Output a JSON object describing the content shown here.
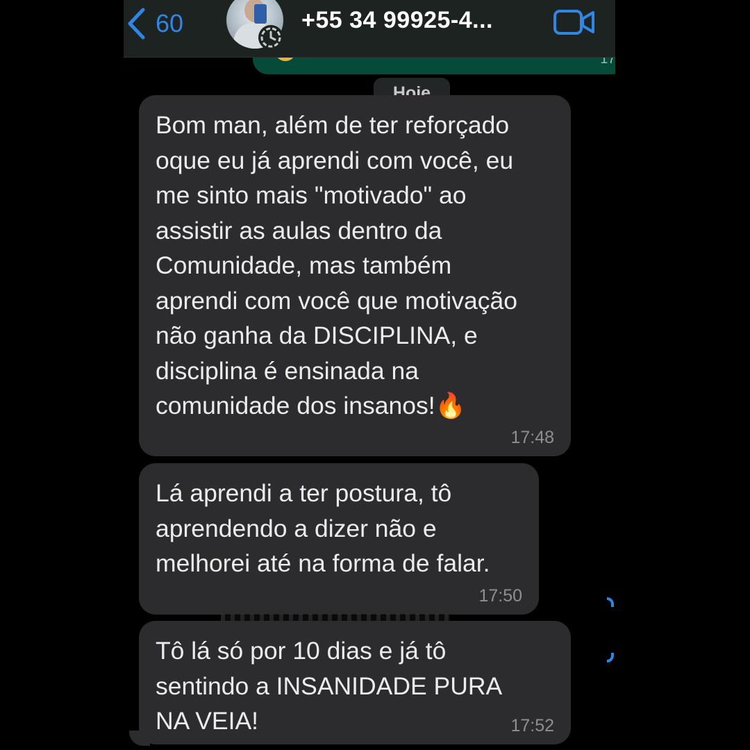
{
  "header": {
    "back_count": "60",
    "contact_name": "+55 34 99925-4...",
    "icons": {
      "back": "chevron-left-icon",
      "video": "video-camera-icon",
      "status": "status-ring-icon"
    },
    "accent_color": "#2f86e6"
  },
  "previous_message": {
    "time": "17:"
  },
  "date_separator": "Hoje",
  "messages": [
    {
      "text": "Bom man, além de ter reforçado\noque eu já aprendi com você, eu\nme sinto mais \"motivado\" ao\nassistir as aulas dentro da\nComunidade, mas também\naprendi com você que motivação\nnão ganha da DISCIPLINA, e\ndisciplina é ensinada na\ncomunidade dos insanos!🔥",
      "time": "17:48"
    },
    {
      "text": "Lá aprendi a ter postura, tô\naprendendo a dizer não e\nmelhorei até na forma de falar.",
      "time": "17:50"
    },
    {
      "text": "Tô lá só por 10 dias e já tô\nsentindo a INSANIDADE PURA\nNA VEIA!",
      "time": "17:52"
    }
  ]
}
